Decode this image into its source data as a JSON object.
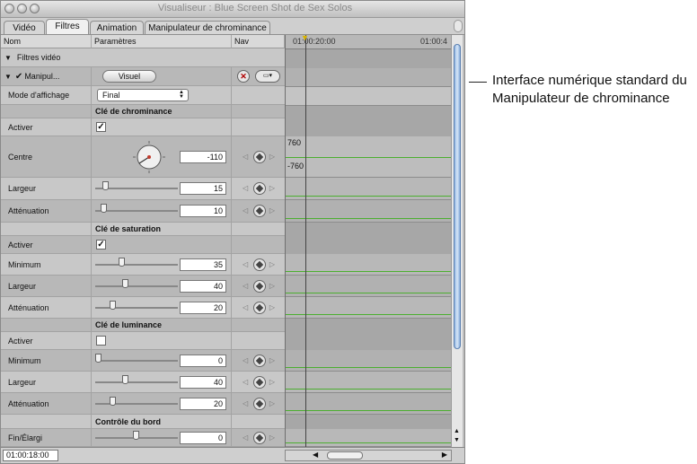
{
  "window": {
    "title": "Visualiseur : Blue Screen Shot de Sex Solos",
    "tabs": [
      "Vidéo",
      "Filtres",
      "Animation",
      "Manipulateur de chrominance"
    ],
    "active_tab": "Filtres"
  },
  "columns": {
    "name": "Nom",
    "params": "Paramètres",
    "nav": "Nav"
  },
  "ruler": {
    "start": "01:00:20:00",
    "end": "01:00:4"
  },
  "rows": {
    "video_filters": "Filtres vidéo",
    "manip": {
      "label": "Manipul...",
      "button": "Visuel"
    },
    "display_mode": {
      "label": "Mode d'affichage",
      "value": "Final"
    },
    "chroma_section": "Clé de chrominance",
    "chroma_enable": "Activer",
    "centre": {
      "label": "Centre",
      "value": "-110"
    },
    "chroma_width": {
      "label": "Largeur",
      "value": "15"
    },
    "chroma_soft": {
      "label": "Atténuation",
      "value": "10"
    },
    "sat_section": "Clé de saturation",
    "sat_enable": "Activer",
    "sat_min": {
      "label": "Minimum",
      "value": "35"
    },
    "sat_width": {
      "label": "Largeur",
      "value": "40"
    },
    "sat_soft": {
      "label": "Atténuation",
      "value": "20"
    },
    "lum_section": "Clé de luminance",
    "lum_enable": "Activer",
    "lum_min": {
      "label": "Minimum",
      "value": "0"
    },
    "lum_width": {
      "label": "Largeur",
      "value": "40"
    },
    "lum_soft": {
      "label": "Atténuation",
      "value": "20"
    },
    "edge_section": "Contrôle du bord",
    "edge_thin": {
      "label": "Fin/Élargi",
      "value": "0"
    }
  },
  "graph": {
    "top": "760",
    "bottom": "-760"
  },
  "timecode": "01:00:18:00",
  "callout": "Interface numérique standard du Manipulateur de chrominance"
}
